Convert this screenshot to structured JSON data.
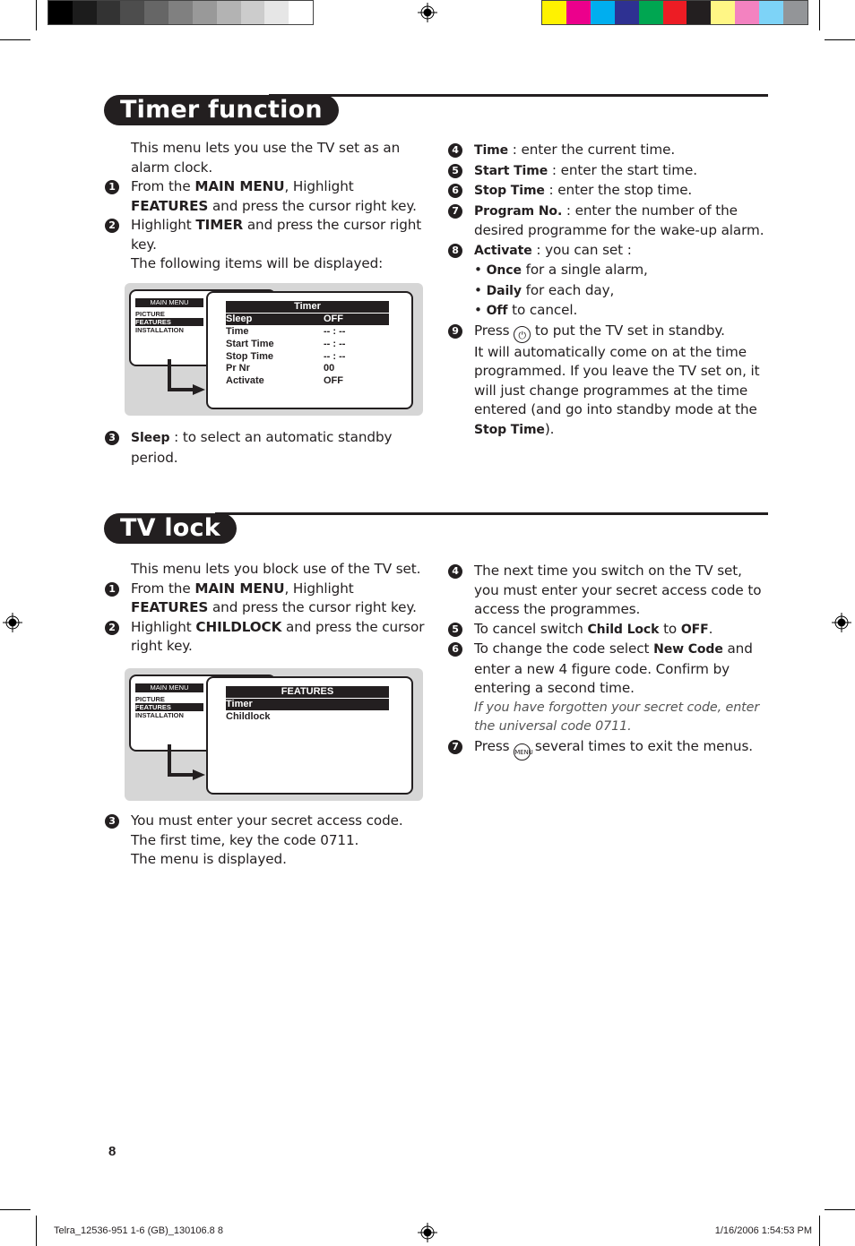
{
  "print_marks": {
    "gray_swatches": [
      "#000000",
      "#1c1c1c",
      "#333333",
      "#4d4d4d",
      "#666666",
      "#808080",
      "#999999",
      "#b3b3b3",
      "#cccccc",
      "#e6e6e6",
      "#ffffff"
    ],
    "color_swatches": [
      "#fff200",
      "#ec008c",
      "#00aeef",
      "#2e3192",
      "#00a651",
      "#ed1c24",
      "#231f20",
      "#fff685",
      "#f382c0",
      "#7dd3f7",
      "#939598"
    ]
  },
  "timer_section": {
    "title": "Timer function",
    "intro": "This menu lets you use the TV set as an alarm clock.",
    "steps_left": [
      {
        "num": "1",
        "pre": "From the ",
        "b1": "MAIN MENU",
        "mid": ", Highlight ",
        "b2": "FEATURES",
        "post": " and press the cursor right key."
      },
      {
        "num": "2",
        "pre": "Highlight ",
        "b1": "TIMER",
        "post": " and press the cursor right key."
      }
    ],
    "following": "The following items will be displayed:",
    "step3": {
      "num": "3",
      "b": "Sleep",
      "text": " : to select an automatic standby period."
    },
    "osd": {
      "main_menu": {
        "header": "MAIN MENU",
        "items": [
          "PICTURE",
          "FEATURES",
          "INSTALLATION"
        ],
        "selected": "FEATURES"
      },
      "submenu": {
        "title": "Timer",
        "rows": [
          {
            "label": "Sleep",
            "value": "OFF",
            "selected": true
          },
          {
            "label": "Time",
            "value": "-- : --"
          },
          {
            "label": "Start Time",
            "value": "-- : --"
          },
          {
            "label": "Stop Time",
            "value": "-- : --"
          },
          {
            "label": "Pr Nr",
            "value": "00"
          },
          {
            "label": "Activate",
            "value": "OFF"
          }
        ]
      }
    },
    "steps_right": [
      {
        "num": "4",
        "b": "Time",
        "text": " : enter the current time."
      },
      {
        "num": "5",
        "b": "Start Time",
        "text": " : enter the start time."
      },
      {
        "num": "6",
        "b": "Stop Time",
        "text": " : enter the stop time."
      },
      {
        "num": "7",
        "b": "Program No.",
        "text": " : enter the number of the desired programme for the wake-up alarm."
      },
      {
        "num": "8",
        "b": "Activate",
        "text": " : you can set :"
      }
    ],
    "activate_options": [
      {
        "b": "Once",
        "text": " for a single alarm,"
      },
      {
        "b": "Daily",
        "text": " for each day,"
      },
      {
        "b": "Off",
        "text": " to cancel."
      }
    ],
    "step9": {
      "num": "9",
      "pre": "Press ",
      "icon": "power-standby-icon",
      "post": " to put the TV set in standby.",
      "cont": "It will automatically come on at the time programmed. If you leave the TV set on, it will just change programmes at the time entered (and go into standby mode at the ",
      "b": "Stop Time",
      "end": ")."
    }
  },
  "tvlock_section": {
    "title": "TV lock",
    "intro": "This menu lets you block use of the TV set.",
    "steps_left": [
      {
        "num": "1",
        "pre": "From the ",
        "b1": "MAIN MENU",
        "mid": ", Highlight ",
        "b2": "FEATURES",
        "post": " and press the cursor right key."
      },
      {
        "num": "2",
        "pre": "Highlight ",
        "b1": "CHILDLOCK",
        "post": " and press the cursor right key."
      }
    ],
    "osd": {
      "main_menu": {
        "header": "MAIN MENU",
        "items": [
          "PICTURE",
          "FEATURES",
          "INSTALLATION"
        ],
        "selected": "FEATURES"
      },
      "submenu": {
        "title": "FEATURES",
        "rows": [
          {
            "label": "Timer",
            "selected": true
          },
          {
            "label": "Childlock"
          }
        ]
      }
    },
    "step3": {
      "num": "3",
      "lines": [
        "You must enter your secret access code.",
        "The first time, key the code 0711.",
        "The menu is displayed."
      ]
    },
    "steps_right": [
      {
        "num": "4",
        "text": "The next time you switch on the TV set, you must enter your secret access code to access the programmes."
      },
      {
        "num": "5",
        "pre": "To cancel switch ",
        "b1": "Child Lock",
        "mid": " to ",
        "b2": "OFF",
        "post": "."
      },
      {
        "num": "6",
        "pre": "To change the code select ",
        "b1": "New Code",
        "post": " and enter a new 4 figure code. Confirm by entering a second time."
      },
      {
        "num": "7",
        "pre": "Press ",
        "icon": "menu-button-icon",
        "icon_label": "MENU",
        "post": " several times to exit the menus."
      }
    ],
    "note": "If you have forgotten your secret code, enter the universal code 0711."
  },
  "footer": {
    "page_number": "8",
    "slug_left": "Telra_12536-951 1-6 (GB)_130106.8   8",
    "slug_right": "1/16/2006   1:54:53 PM"
  }
}
